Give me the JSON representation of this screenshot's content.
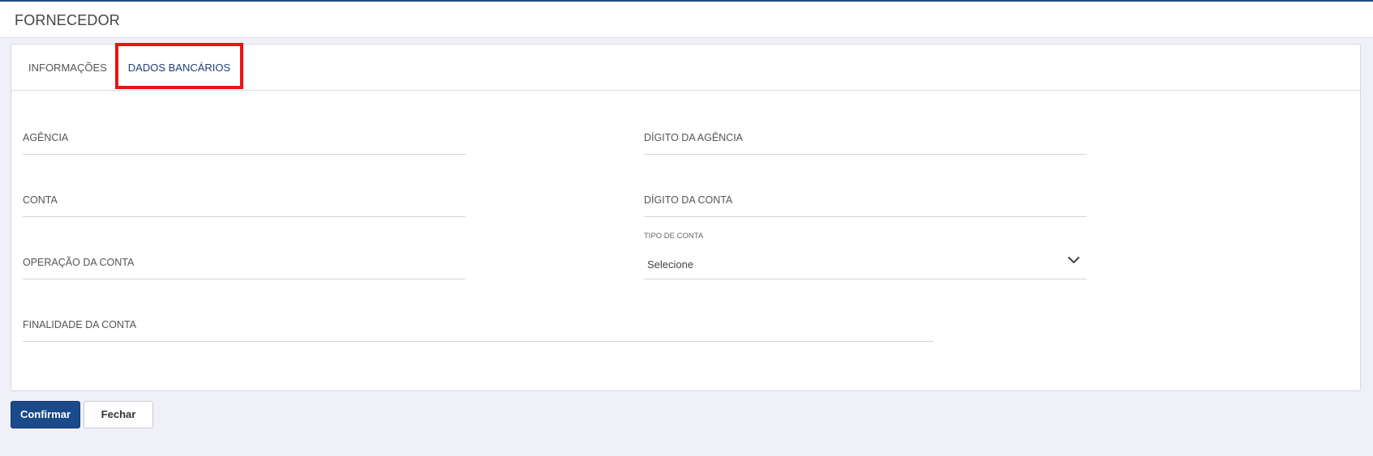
{
  "header": {
    "title": "FORNECEDOR"
  },
  "tabs": [
    {
      "label": "INFORMAÇÕES",
      "active": false
    },
    {
      "label": "DADOS BANCÁRIOS",
      "active": true
    }
  ],
  "form": {
    "agencia": {
      "label": "AGÊNCIA",
      "value": ""
    },
    "digito_agencia": {
      "label": "DÍGITO DA AGÊNCIA",
      "value": ""
    },
    "conta": {
      "label": "CONTA",
      "value": ""
    },
    "digito_conta": {
      "label": "DÍGITO DA CONTA",
      "value": ""
    },
    "operacao_conta": {
      "label": "OPERAÇÃO DA CONTA",
      "value": ""
    },
    "tipo_conta": {
      "label": "TIPO DE CONTA",
      "selected": "Selecione"
    },
    "finalidade_conta": {
      "label": "FINALIDADE DA CONTA",
      "value": ""
    }
  },
  "actions": {
    "confirm_label": "Confirmar",
    "close_label": "Fechar"
  },
  "colors": {
    "primary": "#1b4a8a",
    "highlight": "#ee1111",
    "background": "#eff0f8"
  }
}
